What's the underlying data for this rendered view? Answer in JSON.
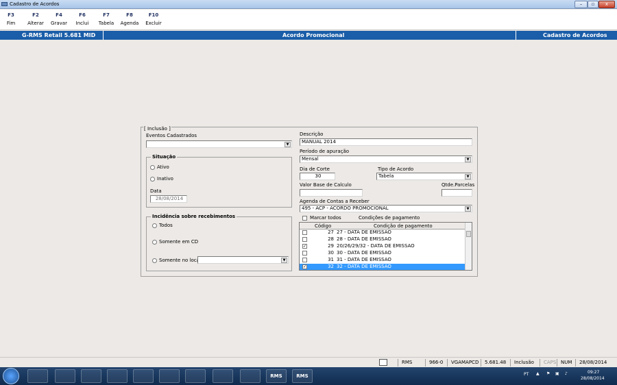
{
  "window": {
    "title": "Cadastro de Acordos",
    "minimize": "–",
    "maximize": "▫",
    "close": "x"
  },
  "toolbar": [
    {
      "key": "F3",
      "label": "Fim"
    },
    {
      "key": "F2",
      "label": "Alterar"
    },
    {
      "key": "F4",
      "label": "Gravar"
    },
    {
      "key": "F6",
      "label": "Inclui"
    },
    {
      "key": "F7",
      "label": "Tabela"
    },
    {
      "key": "F8",
      "label": "Agenda"
    },
    {
      "key": "F10",
      "label": "Excluir"
    }
  ],
  "header": {
    "left": "G-RMS Retail 5.681 MID",
    "center": "Acordo Promocional",
    "right": "Cadastro de Acordos"
  },
  "form": {
    "mode_label": "[ Inclusão ]",
    "eventos_label": "Eventos Cadastrados",
    "eventos_value": "",
    "situacao_title": "Situação",
    "ativo": "Ativo",
    "inativo": "Inativo",
    "data_label": "Data",
    "data_value": "28/08/2014",
    "incidencia_title": "Incidência sobre recebimentos",
    "todos": "Todos",
    "somente_cd": "Somente em CD",
    "somente_local": "Somente no local",
    "somente_local_value": "",
    "descricao_label": "Descrição",
    "descricao_value": "MANUAL 2014",
    "periodo_label": "Período de apuração",
    "periodo_value": "Mensal",
    "dia_corte_label": "Dia de Corte",
    "dia_corte_value": "30",
    "tipo_label": "Tipo de Acordo",
    "tipo_value": "Tabela",
    "valor_base_label": "Valor Base de Calculo",
    "valor_base_value": "",
    "qtde_label": "Qtde.Parcelas",
    "qtde_value": "",
    "agenda_label": "Agenda de Contas a Receber",
    "agenda_value": "495 - ACP - ACORDO PROMOCIONAL",
    "marcar_todos": "Marcar todos",
    "condicoes_label": "Condições de pagamento",
    "grid_head_code": "Código",
    "grid_head_desc": "Condição de pagamento",
    "rows": [
      {
        "checked": false,
        "code": "27",
        "desc": "27 - DATA DE EMISSAO"
      },
      {
        "checked": false,
        "code": "28",
        "desc": "28 - DATA DE EMISSAO"
      },
      {
        "checked": true,
        "code": "29",
        "desc": "20/26/29/32 - DATA DE EMISSAO"
      },
      {
        "checked": false,
        "code": "30",
        "desc": "30 - DATA DE EMISSAO"
      },
      {
        "checked": false,
        "code": "31",
        "desc": "31 - DATA DE EMISSAO"
      },
      {
        "checked": true,
        "code": "32",
        "desc": "32 - DATA DE EMISSAO"
      }
    ]
  },
  "status": [
    "RMS",
    "966-0",
    "VGAMAPCD",
    "5.681.48",
    "Inclusão",
    "CAPS",
    "NUM",
    "28/08/2014"
  ],
  "taskbar": {
    "app1": "RMS",
    "app2": "RMS",
    "lang": "PT",
    "time": "09:27",
    "date": "28/08/2014"
  }
}
